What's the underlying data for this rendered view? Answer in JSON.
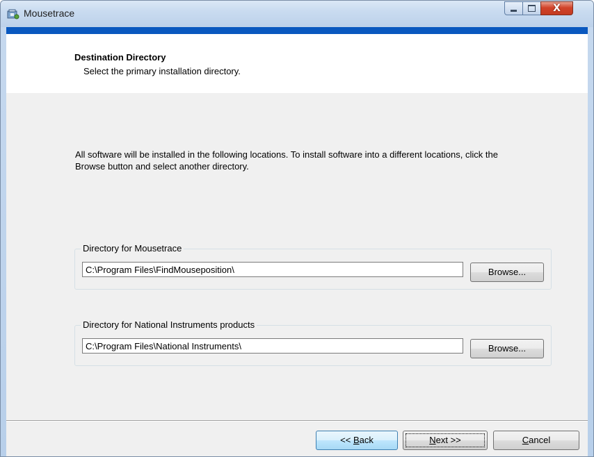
{
  "window": {
    "title": "Mousetrace",
    "controls": {
      "minimize": "minimize",
      "maximize": "maximize",
      "close": "X"
    }
  },
  "header": {
    "title": "Destination Directory",
    "subtitle": "Select the primary installation directory."
  },
  "info_text": "All software will be installed in the following locations. To install software into a different locations, click the Browse button and select another directory.",
  "groups": [
    {
      "label": "Directory for Mousetrace",
      "path": "C:\\Program Files\\FindMouseposition\\",
      "button": "Browse..."
    },
    {
      "label": "Directory for National Instruments products",
      "path": "C:\\Program Files\\National Instruments\\",
      "button": "Browse..."
    }
  ],
  "footer": {
    "back": {
      "prefix": "<< ",
      "accel": "B",
      "rest": "ack"
    },
    "next": {
      "accel": "N",
      "rest": "ext >>"
    },
    "cancel": {
      "accel": "C",
      "rest": "ancel"
    }
  },
  "icons": {
    "app": "installer-icon"
  },
  "colors": {
    "accent_strip": "#0a58bf",
    "close_button": "#c43b21",
    "titlebar": "#c9dbf0"
  }
}
